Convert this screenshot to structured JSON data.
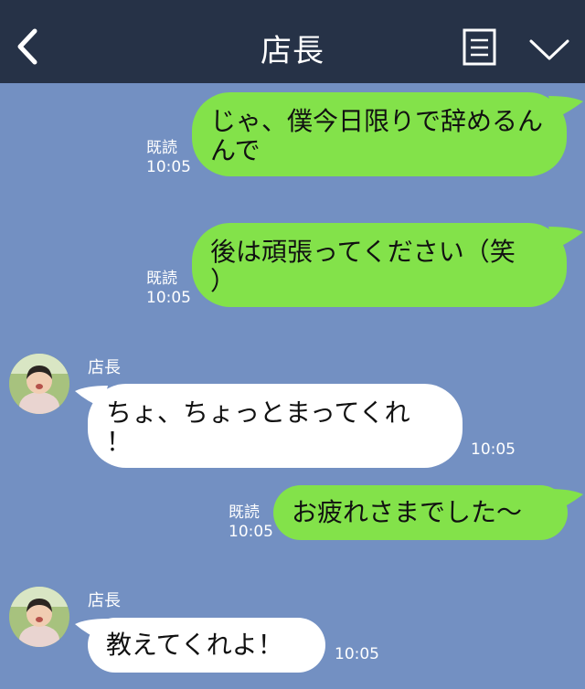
{
  "header": {
    "title": "店長",
    "back_icon": "chevron-left-icon",
    "memo_icon": "note-icon",
    "menu_icon": "chevron-down-icon"
  },
  "colors": {
    "header_bg": "#263247",
    "chat_bg": "#7390c2",
    "my_bubble": "#83e24a",
    "their_bubble": "#ffffff"
  },
  "messages": [
    {
      "from": "me",
      "text_line1": "じゃ、僕今日限りで辞めるん",
      "text_line2": "んで",
      "read": "既読",
      "time": "10:05"
    },
    {
      "from": "me",
      "text_line1": "後は頑張ってください（笑",
      "text_line2": "）",
      "read": "既読",
      "time": "10:05"
    },
    {
      "from": "them",
      "sender": "店長",
      "text_line1": "ちょ、ちょっとまってくれ",
      "text_line2": "！",
      "time": "10:05"
    },
    {
      "from": "me",
      "text": "お疲れさまでした〜",
      "read": "既読",
      "time": "10:05"
    },
    {
      "from": "them",
      "sender": "店長",
      "text": "教えてくれよ！",
      "time": "10:05"
    }
  ]
}
